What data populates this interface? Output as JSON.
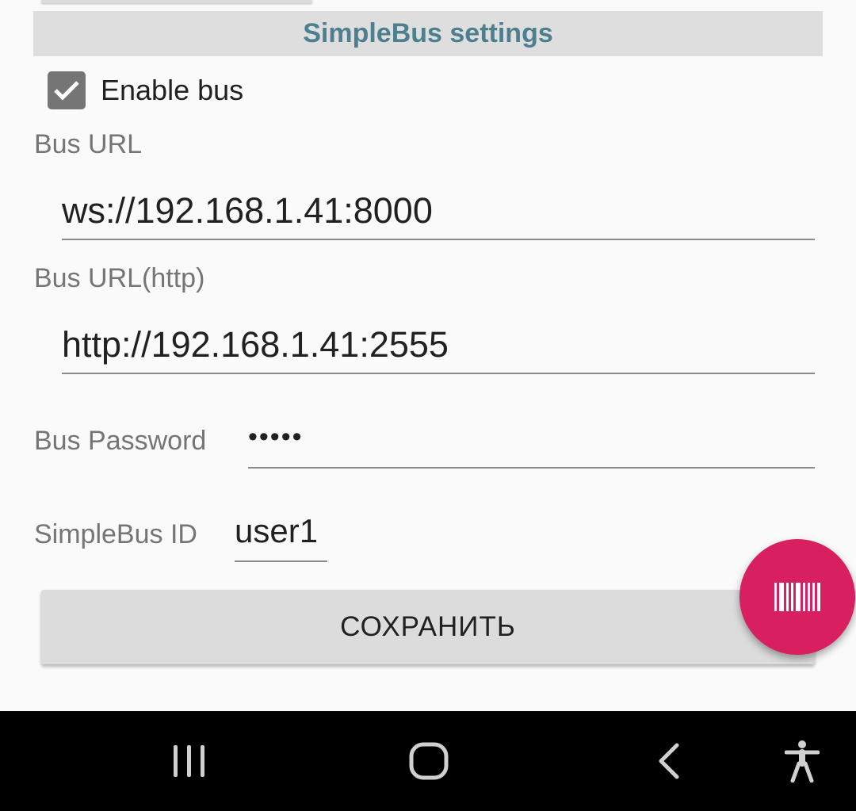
{
  "section": {
    "title": "SimpleBus settings"
  },
  "enable_bus": {
    "label": "Enable bus",
    "checked": true
  },
  "bus_url": {
    "label": "Bus URL",
    "value": "ws://192.168.1.41:8000"
  },
  "bus_url_http": {
    "label": "Bus URL(http)",
    "value": "http://192.168.1.41:2555"
  },
  "bus_password": {
    "label": "Bus Password",
    "value": "•••••"
  },
  "simplebus_id": {
    "label": "SimpleBus ID",
    "value": "user1"
  },
  "save_button": {
    "label": "СОХРАНИТЬ"
  },
  "fab": {
    "icon": "barcode-icon",
    "color": "#d81f5f"
  },
  "navbar": {
    "recents_icon": "recents-icon",
    "home_icon": "home-icon",
    "back_icon": "back-icon",
    "accessibility_icon": "accessibility-icon"
  },
  "colors": {
    "header_text": "#4e7f8e",
    "header_bg": "#dedede",
    "checkbox": "#757575"
  }
}
